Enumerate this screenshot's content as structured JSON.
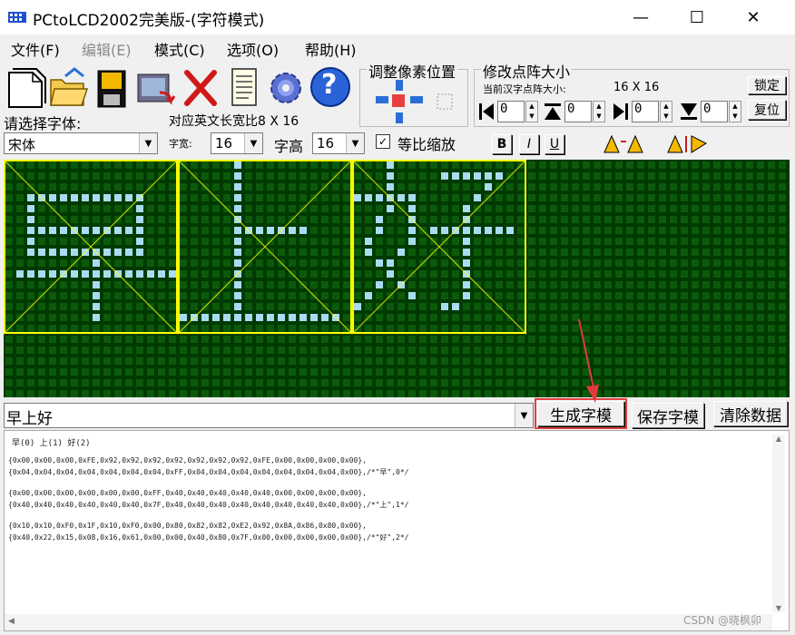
{
  "window": {
    "title": "PCtoLCD2002完美版-(字符模式)",
    "min_glyph": "—",
    "max_glyph": "☐",
    "close_glyph": "✕"
  },
  "menu": [
    "文件(F)",
    "编辑(E)",
    "模式(C)",
    "选项(O)",
    "帮助(H)"
  ],
  "toolbar": {
    "icons": [
      "new-file-icon",
      "open-folder-icon",
      "save-disk-icon",
      "import-image-icon",
      "delete-x-icon",
      "notes-icon",
      "settings-gear-icon",
      "help-icon"
    ],
    "help_glyph": "?"
  },
  "adjust_group": {
    "title": "调整像素位置"
  },
  "matrix_group": {
    "title": "修改点阵大小",
    "current_label": "当前汉字点阵大小:",
    "current_size": "16 X 16",
    "lock": "锁定",
    "reset": "复位",
    "spinners": [
      "0",
      "0",
      "0",
      "0"
    ]
  },
  "font": {
    "choose_label": "请选择字体:",
    "english_ratio": "对应英文长宽比8 X 16",
    "font_name": "宋体",
    "width_label": "字宽:",
    "width_value": "16",
    "height_label": "字高",
    "height_value": "16",
    "scale_label": "等比缩放",
    "scale_checked": "✓",
    "bold": "B",
    "italic": "I",
    "underline": "U"
  },
  "canvas_colors": {
    "bg": "#003a00",
    "dot_off": "#0b5a0b",
    "dot_on": "#a8dcf0",
    "frame": "#ffff00"
  },
  "input": {
    "text": "早上好",
    "generate": "生成字模",
    "save": "保存字模",
    "clear": "清除数据"
  },
  "output": {
    "header": "早(0) 上(1) 好(2)",
    "lines": [
      "{0x00,0x00,0x00,0xFE,0x92,0x92,0x92,0x92,0x92,0x92,0x92,0xFE,0x00,0x00,0x00,0x00},",
      "{0x04,0x04,0x04,0x04,0x04,0x04,0x04,0xFF,0x04,0x04,0x04,0x04,0x04,0x04,0x04,0x00},/*\"早\",0*/",
      "",
      "{0x00,0x00,0x00,0x00,0x00,0x00,0xFF,0x40,0x40,0x40,0x40,0x40,0x00,0x00,0x00,0x00},",
      "{0x40,0x40,0x40,0x40,0x40,0x40,0x7F,0x40,0x40,0x40,0x40,0x40,0x40,0x40,0x40,0x00},/*\"上\",1*/",
      "",
      "{0x10,0x10,0xF0,0x1F,0x10,0xF0,0x00,0x80,0x82,0x82,0xE2,0x92,0x8A,0x86,0x80,0x00},",
      "{0x40,0x22,0x15,0x08,0x16,0x61,0x00,0x00,0x40,0x80,0x7F,0x00,0x00,0x00,0x00,0x00},/*\"好\",2*/"
    ]
  },
  "watermark": "CSDN @晓枫卯"
}
